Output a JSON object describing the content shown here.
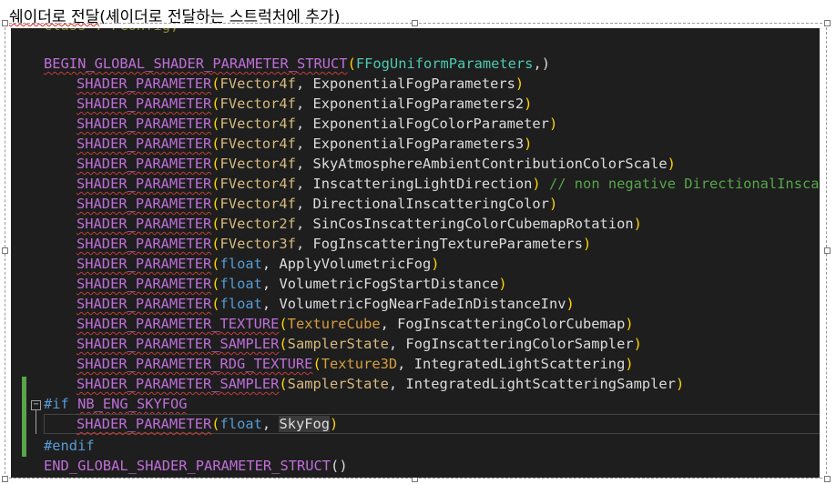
{
  "caption": {
    "prefix": "쉐이더로 전달",
    "rest": "(셰이더로 전달하는 스트럭처에 추가)"
  },
  "code": {
    "top_partial": "class : FConfig;",
    "struct_begin": {
      "macro": "BEGIN_GLOBAL_SHADER_PARAMETER_STRUCT",
      "open": "(",
      "name": "FFogUniformParameters",
      "close": ",)"
    },
    "params": [
      {
        "macro": "SHADER_PARAMETER",
        "type": "FVector4f",
        "name": "ExponentialFogParameters",
        "kind": "tpl"
      },
      {
        "macro": "SHADER_PARAMETER",
        "type": "FVector4f",
        "name": "ExponentialFogParameters2",
        "kind": "tpl"
      },
      {
        "macro": "SHADER_PARAMETER",
        "type": "FVector4f",
        "name": "ExponentialFogColorParameter",
        "kind": "tpl"
      },
      {
        "macro": "SHADER_PARAMETER",
        "type": "FVector4f",
        "name": "ExponentialFogParameters3",
        "kind": "tpl"
      },
      {
        "macro": "SHADER_PARAMETER",
        "type": "FVector4f",
        "name": "SkyAtmosphereAmbientContributionColorScale",
        "kind": "tpl"
      },
      {
        "macro": "SHADER_PARAMETER",
        "type": "FVector4f",
        "name": "InscatteringLightDirection",
        "kind": "tpl",
        "comment": "// non negative DirectionalInscatte"
      },
      {
        "macro": "SHADER_PARAMETER",
        "type": "FVector4f",
        "name": "DirectionalInscatteringColor",
        "kind": "tpl"
      },
      {
        "macro": "SHADER_PARAMETER",
        "type": "FVector2f",
        "name": "SinCosInscatteringColorCubemapRotation",
        "kind": "tpl"
      },
      {
        "macro": "SHADER_PARAMETER",
        "type": "FVector3f",
        "name": "FogInscatteringTextureParameters",
        "kind": "tpl"
      },
      {
        "macro": "SHADER_PARAMETER",
        "type": "float",
        "name": "ApplyVolumetricFog",
        "kind": "kw"
      },
      {
        "macro": "SHADER_PARAMETER",
        "type": "float",
        "name": "VolumetricFogStartDistance",
        "kind": "kw"
      },
      {
        "macro": "SHADER_PARAMETER",
        "type": "float",
        "name": "VolumetricFogNearFadeInDistanceInv",
        "kind": "kw"
      },
      {
        "macro": "SHADER_PARAMETER_TEXTURE",
        "type": "TextureCube",
        "name": "FogInscatteringColorCubemap",
        "kind": "tex"
      },
      {
        "macro": "SHADER_PARAMETER_SAMPLER",
        "type": "SamplerState",
        "name": "FogInscatteringColorSampler",
        "kind": "tpl"
      },
      {
        "macro": "SHADER_PARAMETER_RDG_TEXTURE",
        "type": "Texture3D",
        "name": "IntegratedLightScattering",
        "kind": "tex"
      },
      {
        "macro": "SHADER_PARAMETER_SAMPLER",
        "type": "SamplerState",
        "name": "IntegratedLightScatteringSampler",
        "kind": "tpl"
      }
    ],
    "if_line": {
      "directive": "#if",
      "symbol": "NB_ENG_SKYFOG"
    },
    "skyfog": {
      "macro": "SHADER_PARAMETER",
      "type": "float",
      "name": "SkyFog"
    },
    "endif": "#endif",
    "struct_end": {
      "macro": "END_GLOBAL_SHADER_PARAMETER_STRUCT",
      "args": "()"
    }
  }
}
